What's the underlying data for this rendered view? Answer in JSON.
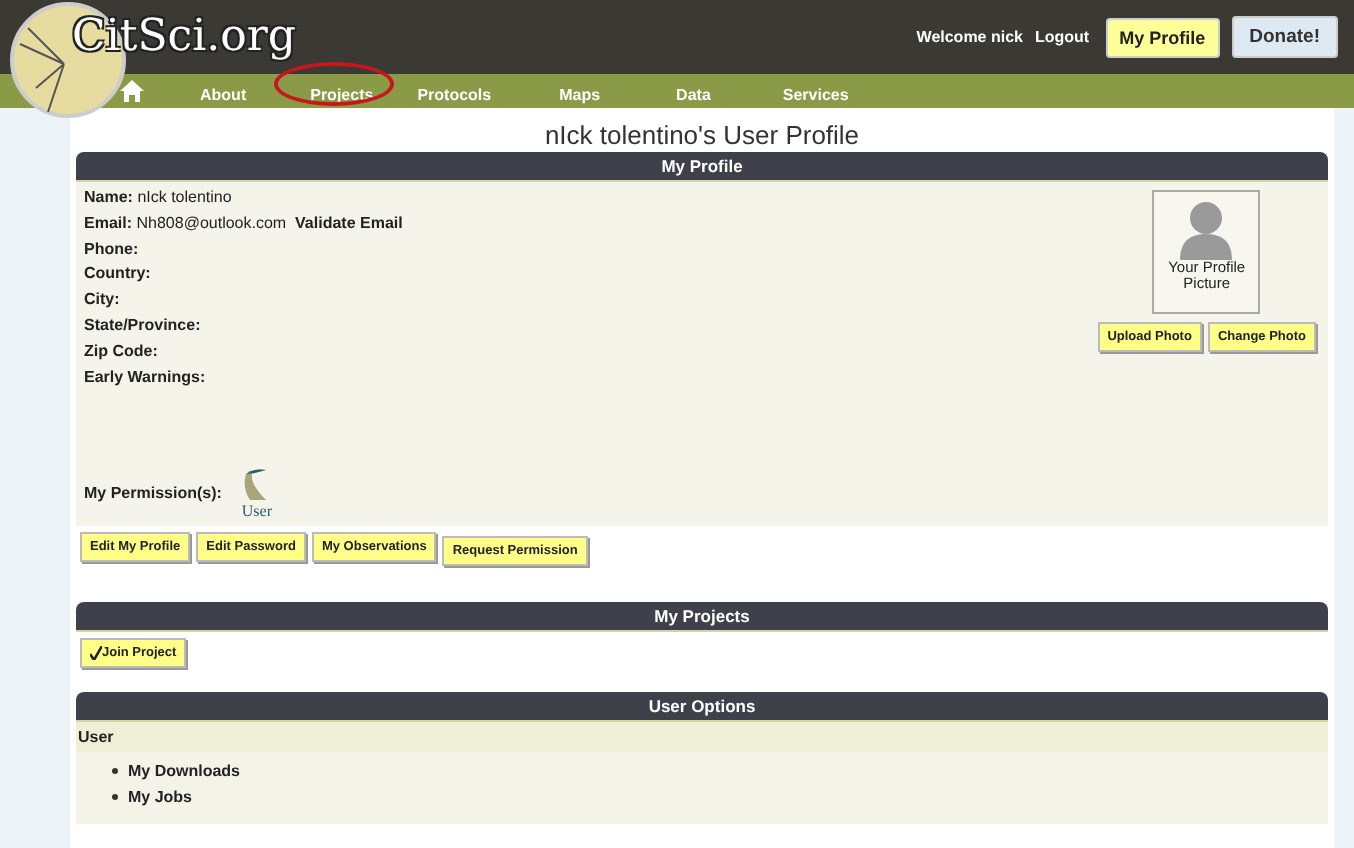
{
  "header": {
    "logo_text": "CitSci.org",
    "welcome": "Welcome nick",
    "logout": "Logout",
    "my_profile": "My Profile",
    "donate": "Donate!"
  },
  "nav": [
    {
      "label": "About",
      "highlighted": false
    },
    {
      "label": "Projects",
      "highlighted": true
    },
    {
      "label": "Protocols",
      "highlighted": false
    },
    {
      "label": "Maps",
      "highlighted": false
    },
    {
      "label": "Data",
      "highlighted": false
    },
    {
      "label": "Services",
      "highlighted": false
    }
  ],
  "page_title": "nIck tolentino's User Profile",
  "profile": {
    "title": "My Profile",
    "fields": [
      {
        "label": "Name:",
        "value": "nIck tolentino"
      },
      {
        "label": "Email:",
        "value": "Nh808@outlook.com",
        "action": "Validate Email"
      },
      {
        "label": "Phone:"
      },
      {
        "label": "Country:"
      },
      {
        "label": "City:"
      },
      {
        "label": "State/Province:"
      },
      {
        "label": "Zip Code:"
      },
      {
        "label": "Early Warnings:"
      }
    ],
    "permissions_label": "My Permission(s):",
    "permission": "User",
    "picture_caption": "Your Profile Picture",
    "photo_buttons": [
      "Upload Photo",
      "Change Photo"
    ],
    "buttons": [
      "Edit My Profile",
      "Edit Password",
      "My Observations",
      "Request Permission"
    ]
  },
  "projects": {
    "title": "My Projects",
    "join_button": "Join Project"
  },
  "user_options": {
    "title": "User Options",
    "group": "User",
    "items": [
      "My Downloads",
      "My Jobs"
    ]
  }
}
